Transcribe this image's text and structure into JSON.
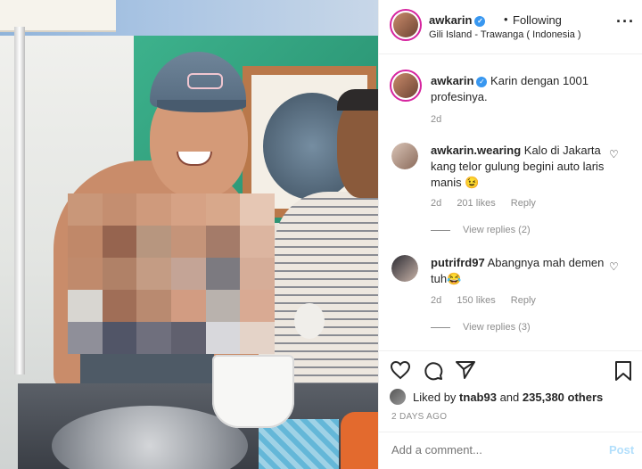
{
  "post": {
    "username": "awkarin",
    "verified_mark": "✓",
    "dot": "•",
    "follow_status": "Following",
    "location": "Gili Island - Trawanga ( Indonesia )",
    "more_icon": "more-icon"
  },
  "caption": {
    "username": "awkarin",
    "text": "Karin dengan 1001 profesinya.",
    "time": "2d"
  },
  "comments": [
    {
      "username": "awkarin.wearing",
      "text": "Kalo di Jakarta kang telor gulung begini auto laris manis 😉",
      "time": "2d",
      "likes": "201 likes",
      "reply": "Reply",
      "view_replies": "View replies (2)"
    },
    {
      "username": "putrifrd97",
      "text": "Abangnya mah demen tuh😂",
      "time": "2d",
      "likes": "150 likes",
      "reply": "Reply",
      "view_replies": "View replies (3)"
    }
  ],
  "actions": {
    "like_icon": "♡",
    "comment_icon": "◯",
    "share_icon": "➤",
    "save_icon": "🔖"
  },
  "likes": {
    "prefix": "Liked by",
    "user": "tnab93",
    "mid": "and",
    "others": "235,380 others"
  },
  "date": "2 DAYS AGO",
  "add_comment": {
    "placeholder": "Add a comment...",
    "post_label": "Post"
  },
  "colors": {
    "verified": "#3897f0",
    "story_ring": "#d6249f",
    "muted": "#8e8e8e",
    "post_button": "#b2dffc"
  }
}
